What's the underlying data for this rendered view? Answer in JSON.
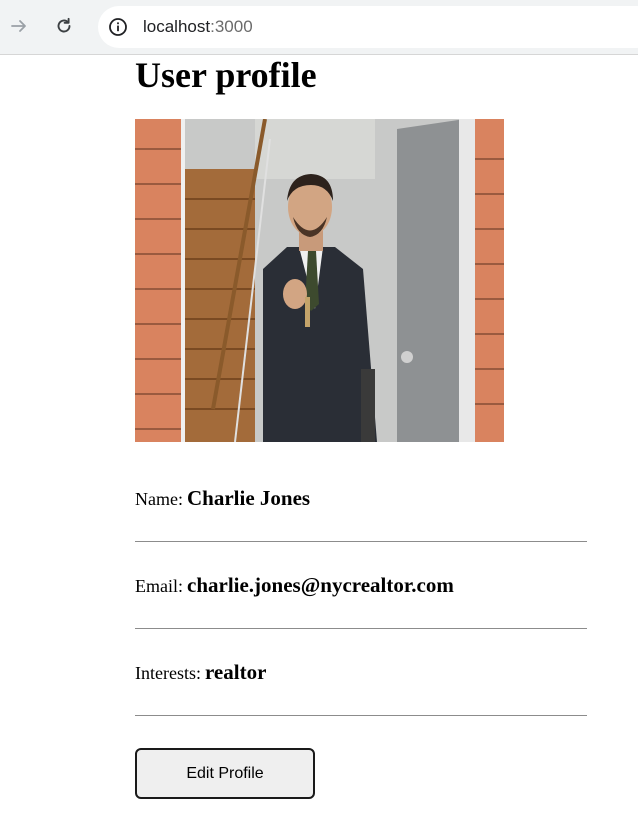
{
  "browser": {
    "host": "localhost",
    "port": ":3000"
  },
  "page": {
    "title": "User profile"
  },
  "profile": {
    "photo_alt": "",
    "name_label": "Name:",
    "name_value": "Charlie Jones",
    "email_label": "Email:",
    "email_value": "charlie.jones@nycrealtor.com",
    "interests_label": "Interests:",
    "interests_value": "realtor"
  },
  "actions": {
    "edit_label": "Edit Profile"
  },
  "colors": {
    "brick": "#d9835f",
    "suit": "#2a2e36",
    "rule": "#8c8c8c"
  }
}
